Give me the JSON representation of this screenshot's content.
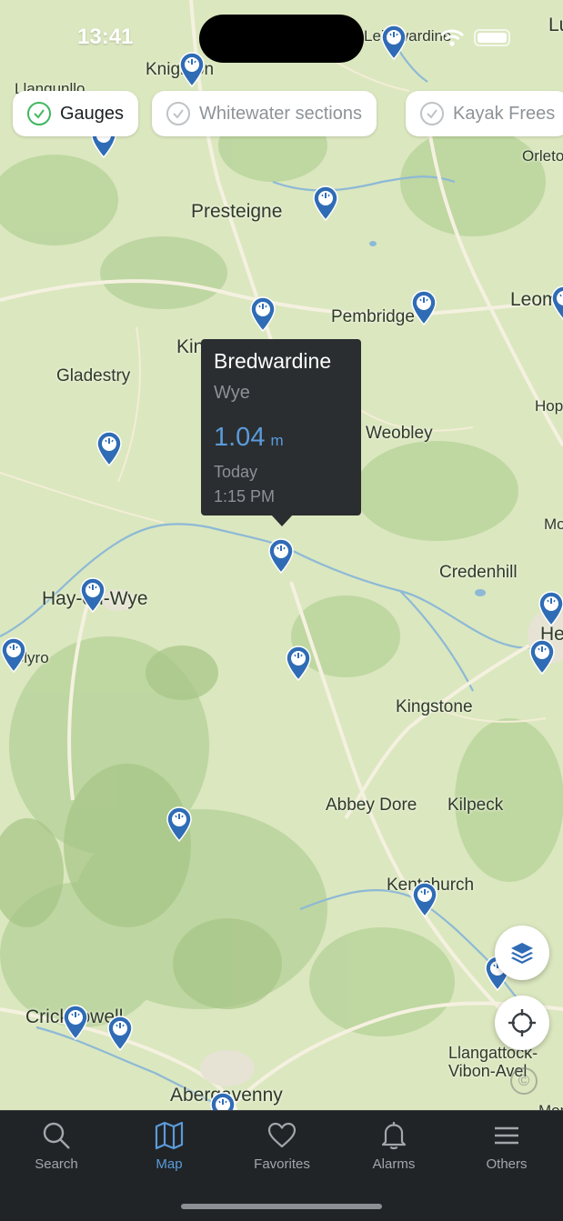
{
  "status_bar": {
    "time": "13:41"
  },
  "filters": [
    {
      "label": "Gauges",
      "active": true
    },
    {
      "label": "Whitewater sections",
      "active": false
    },
    {
      "label": "Kayak Frees",
      "active": false
    }
  ],
  "map": {
    "places": [
      "Knighton",
      "Llangunllo",
      "Leintwardine",
      "Presteigne",
      "Pembridge",
      "Leominster",
      "Orleton",
      "Kington",
      "Gladestry",
      "Weobley",
      "Hope under Dinmore",
      "Moreton on Lugg",
      "Credenhill",
      "Hay-on-Wye",
      "Clyro",
      "Hereford",
      "Kingstone",
      "Abbey Dore",
      "Kilpeck",
      "Kentchurch",
      "Crickhowell",
      "Llangattock-Vibon-Avel",
      "Abergavenny",
      "Monmouth",
      "Ludlow"
    ]
  },
  "tooltip": {
    "station": "Bredwardine",
    "river": "Wye",
    "value": "1.04",
    "unit": "m",
    "day": "Today",
    "time": "1:15 PM"
  },
  "buttons": {
    "layers_icon": "layers-icon",
    "locate_icon": "crosshair-icon"
  },
  "tabs": [
    {
      "label": "Search",
      "icon": "search-icon"
    },
    {
      "label": "Map",
      "icon": "map-icon"
    },
    {
      "label": "Favorites",
      "icon": "heart-icon"
    },
    {
      "label": "Alarms",
      "icon": "bell-icon"
    },
    {
      "label": "Others",
      "icon": "menu-icon"
    }
  ],
  "colors": {
    "accent": "#5b9bd9",
    "pin": "#2f6cb5",
    "check": "#3fb75f",
    "tabbar": "#202427"
  }
}
